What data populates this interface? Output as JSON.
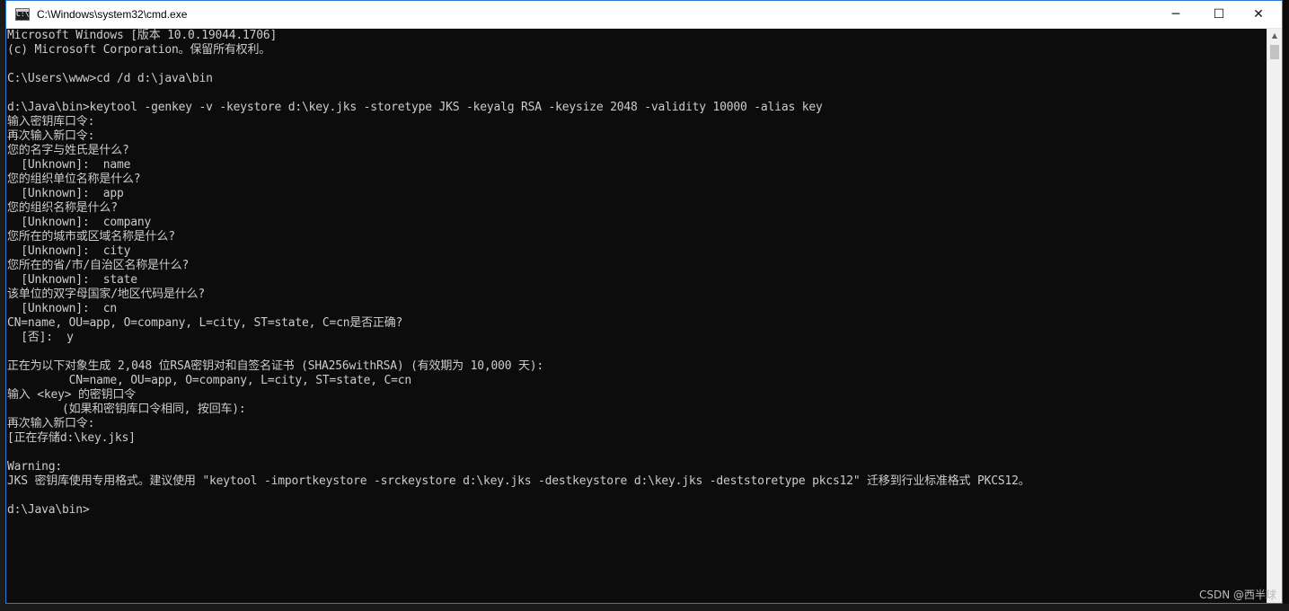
{
  "window": {
    "title": "C:\\Windows\\system32\\cmd.exe",
    "minimize_glyph": "─",
    "maximize_glyph": "☐",
    "close_glyph": "✕",
    "icon": "cmd-app-icon",
    "icon_glyph": "C:\\"
  },
  "console": {
    "lines": [
      "Microsoft Windows [版本 10.0.19044.1706]",
      "(c) Microsoft Corporation。保留所有权利。",
      "",
      "C:\\Users\\www>cd /d d:\\java\\bin",
      "",
      "d:\\Java\\bin>keytool -genkey -v -keystore d:\\key.jks -storetype JKS -keyalg RSA -keysize 2048 -validity 10000 -alias key",
      "输入密钥库口令:",
      "再次输入新口令:",
      "您的名字与姓氏是什么?",
      "  [Unknown]:  name",
      "您的组织单位名称是什么?",
      "  [Unknown]:  app",
      "您的组织名称是什么?",
      "  [Unknown]:  company",
      "您所在的城市或区域名称是什么?",
      "  [Unknown]:  city",
      "您所在的省/市/自治区名称是什么?",
      "  [Unknown]:  state",
      "该单位的双字母国家/地区代码是什么?",
      "  [Unknown]:  cn",
      "CN=name, OU=app, O=company, L=city, ST=state, C=cn是否正确?",
      "  [否]:  y",
      "",
      "正在为以下对象生成 2,048 位RSA密钥对和自签名证书 (SHA256withRSA) (有效期为 10,000 天):",
      "         CN=name, OU=app, O=company, L=city, ST=state, C=cn",
      "输入 <key> 的密钥口令",
      "        (如果和密钥库口令相同, 按回车):",
      "再次输入新口令:",
      "[正在存储d:\\key.jks]",
      "",
      "Warning:",
      "JKS 密钥库使用专用格式。建议使用 \"keytool -importkeystore -srckeystore d:\\key.jks -destkeystore d:\\key.jks -deststoretype pkcs12\" 迁移到行业标准格式 PKCS12。",
      "",
      "d:\\Java\\bin>"
    ]
  },
  "scrollbar": {
    "up_glyph": "▲"
  },
  "watermark": "CSDN @西半球"
}
